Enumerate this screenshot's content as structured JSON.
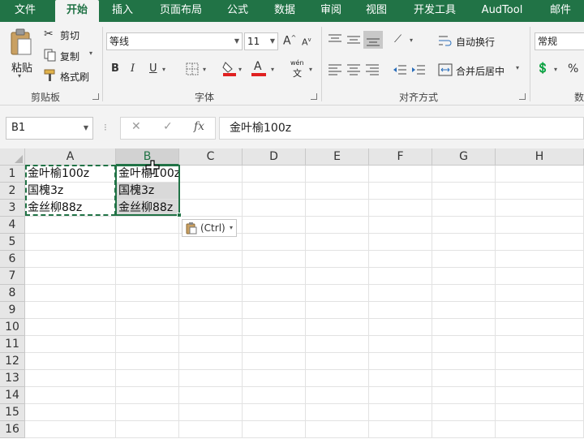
{
  "tabs": [
    "文件",
    "开始",
    "插入",
    "页面布局",
    "公式",
    "数据",
    "审阅",
    "视图",
    "开发工具",
    "AudTool",
    "邮件"
  ],
  "clipboard": {
    "paste_label": "粘贴",
    "cut_label": "剪切",
    "copy_label": "复制",
    "format_painter_label": "格式刷",
    "group_label": "剪贴板"
  },
  "font": {
    "font_name": "等线",
    "font_size": "11",
    "bold": "B",
    "italic": "I",
    "underline": "U",
    "phonetic": "wén",
    "phonetic_sub": "文",
    "grow": "A",
    "shrink": "A",
    "color_letter": "A",
    "group_label": "字体"
  },
  "alignment": {
    "wrap_text_label": "自动换行",
    "merge_center_label": "合并后居中",
    "group_label": "对齐方式"
  },
  "number": {
    "format_label": "常规",
    "percent": "%",
    "group_label": "数"
  },
  "formula_bar": {
    "name_box": "B1",
    "cancel": "✕",
    "enter": "✓",
    "fx": "fx",
    "content": "金叶榆100z"
  },
  "grid": {
    "columns": [
      "A",
      "B",
      "C",
      "D",
      "E",
      "F",
      "G",
      "H"
    ],
    "rows": [
      "1",
      "2",
      "3",
      "4",
      "5",
      "6",
      "7",
      "8",
      "9",
      "10",
      "11",
      "12",
      "13",
      "14",
      "15",
      "16"
    ],
    "cells": {
      "A1": "金叶榆100z",
      "A2": "国槐3z",
      "A3": "金丝柳88z",
      "B1": "金叶榆100z",
      "B2": "国槐3z",
      "B3": "金丝柳88z"
    },
    "selected_column": "B"
  },
  "paste_options": {
    "label": "(Ctrl)"
  },
  "colors": {
    "accent": "#217346",
    "ribbon_bg": "#f3f3f3"
  }
}
